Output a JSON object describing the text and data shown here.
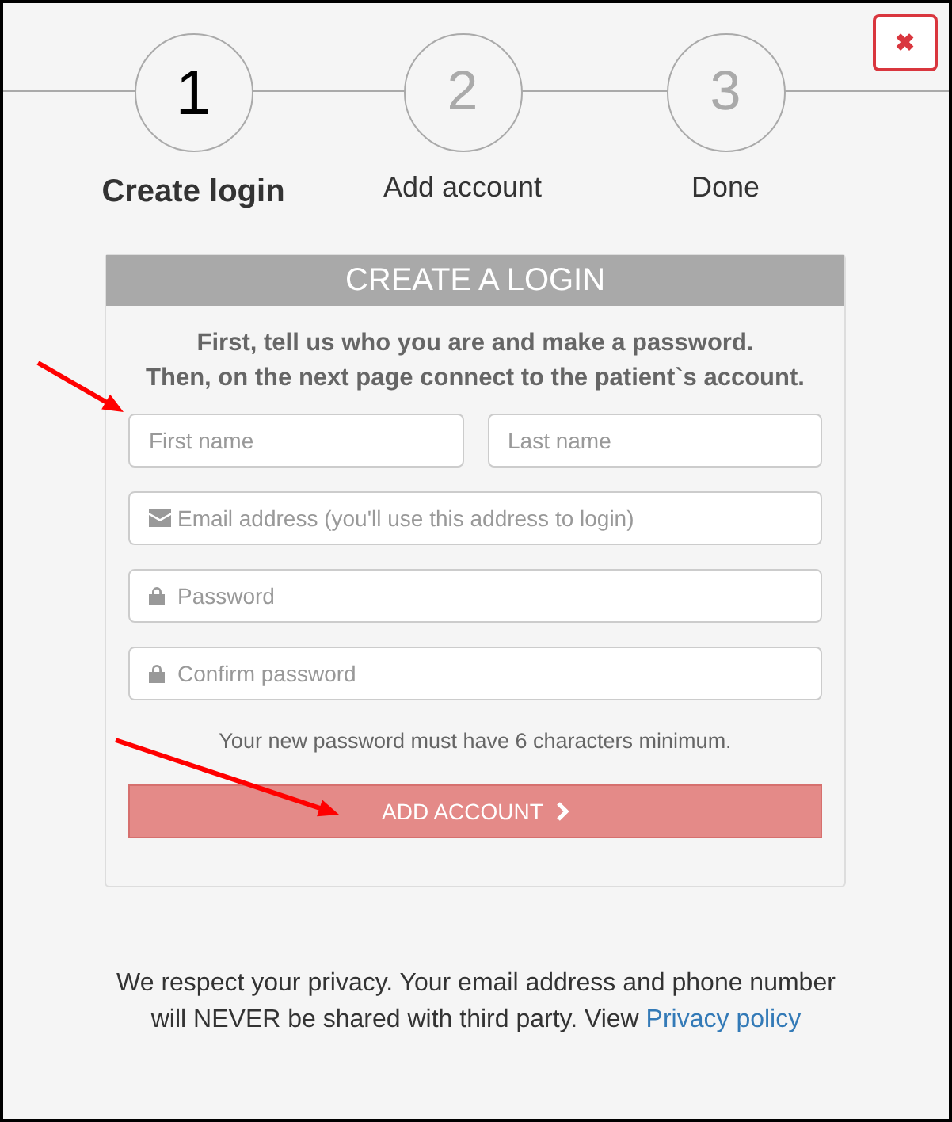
{
  "close_button": {
    "label": "✖"
  },
  "steps": [
    {
      "number": "1",
      "label": "Create login",
      "selected": true
    },
    {
      "number": "2",
      "label": "Add account",
      "selected": false
    },
    {
      "number": "3",
      "label": "Done",
      "selected": false
    }
  ],
  "form": {
    "title": "CREATE A LOGIN",
    "intro": [
      "First, tell us who you are and make a password.",
      "Then, on the next page connect to the patient`s account."
    ],
    "fields": [
      {
        "placeholder": "First name",
        "kind": "plain"
      },
      {
        "placeholder": "Last name",
        "kind": "plain"
      },
      {
        "placeholder": "Email address (you'll use this address to login)",
        "kind": "email"
      },
      {
        "placeholder": "Password",
        "kind": "password"
      },
      {
        "placeholder": "Confirm password",
        "kind": "password"
      }
    ],
    "hint": "Your new password must have 6 characters minimum.",
    "submit": {
      "label": "ADD ACCOUNT",
      "disabled": true
    }
  },
  "privacy": {
    "text": "We respect your privacy. Your email address and phone number will NEVER be shared with third party. View ",
    "link": "Privacy policy"
  },
  "annotations": [
    {
      "kind": "arrow"
    },
    {
      "kind": "arrow"
    }
  ]
}
